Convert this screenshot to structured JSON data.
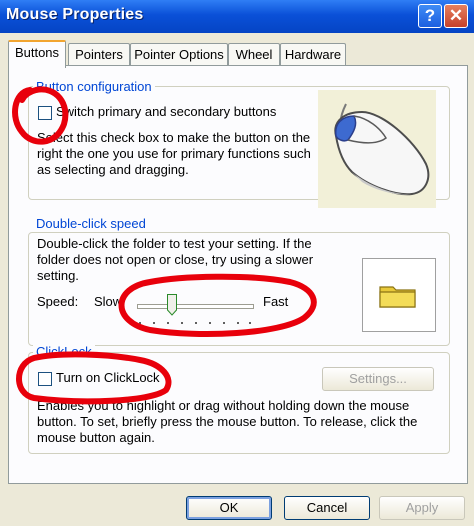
{
  "window": {
    "title": "Mouse Properties",
    "help_glyph": "?",
    "close_glyph": "✕"
  },
  "tabs": [
    {
      "label": "Buttons"
    },
    {
      "label": "Pointers"
    },
    {
      "label": "Pointer Options"
    },
    {
      "label": "Wheel"
    },
    {
      "label": "Hardware"
    }
  ],
  "active_tab": "Buttons",
  "button_configuration": {
    "title": "Button configuration",
    "checkbox_label": "Switch primary and secondary buttons",
    "checked": false,
    "description": [
      "Select this check box to make the button on the",
      "right the one you use for primary functions such",
      "as selecting and dragging."
    ]
  },
  "double_click": {
    "title": "Double-click speed",
    "description": [
      "Double-click the folder to test your setting. If the",
      "folder does not open or close, try using a slower",
      "setting."
    ],
    "speed_label": "Speed:",
    "slow_label": "Slow",
    "fast_label": "Fast",
    "slider_value": 0.3
  },
  "clicklock": {
    "title": "ClickLock",
    "checkbox_label": "Turn on ClickLock",
    "checked": false,
    "settings_label": "Settings...",
    "description": [
      "Enables you to highlight or drag without holding down the mouse",
      "button. To set, briefly press the mouse button. To release, click the",
      "mouse button again."
    ]
  },
  "footer": {
    "ok_label": "OK",
    "cancel_label": "Cancel",
    "apply_label": "Apply"
  },
  "colors": {
    "group_title": "#0046d5",
    "annotation_red": "#e8000b",
    "title_bar": "#0a50d8"
  }
}
